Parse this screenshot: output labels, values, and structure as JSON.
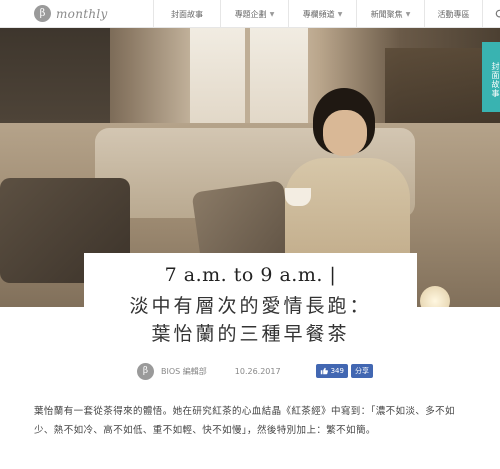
{
  "header": {
    "logo_mark": "β",
    "logo_text": "monthly",
    "nav": [
      {
        "label": "封面故事",
        "has_dropdown": false
      },
      {
        "label": "專題企劃",
        "has_dropdown": true
      },
      {
        "label": "專欄頻道",
        "has_dropdown": true
      },
      {
        "label": "新聞聚焦",
        "has_dropdown": true
      },
      {
        "label": "活動專區",
        "has_dropdown": false
      }
    ],
    "search_icon": "search-icon"
  },
  "side_tag": "封面故事",
  "article": {
    "title_en": "7 a.m. to 9 a.m. |",
    "title_zh_line1": "淡中有層次的愛情長跑：",
    "title_zh_line2": "葉怡蘭的三種早餐茶",
    "author_mark": "β",
    "author": "BIOS 編輯部",
    "date": "10.26.2017",
    "like_icon": "thumbs-up-icon",
    "like_count": "349",
    "share_label": "分享",
    "body": "葉怡蘭有一套從茶得來的體悟。她在研究紅茶的心血結晶《紅茶經》中寫到：「濃不如淡、多不如少、熱不如冷、高不如低、重不如輕、快不如慢」，然後特別加上：繁不如簡。"
  },
  "colors": {
    "accent": "#39b3b1",
    "facebook": "#4267b2"
  }
}
